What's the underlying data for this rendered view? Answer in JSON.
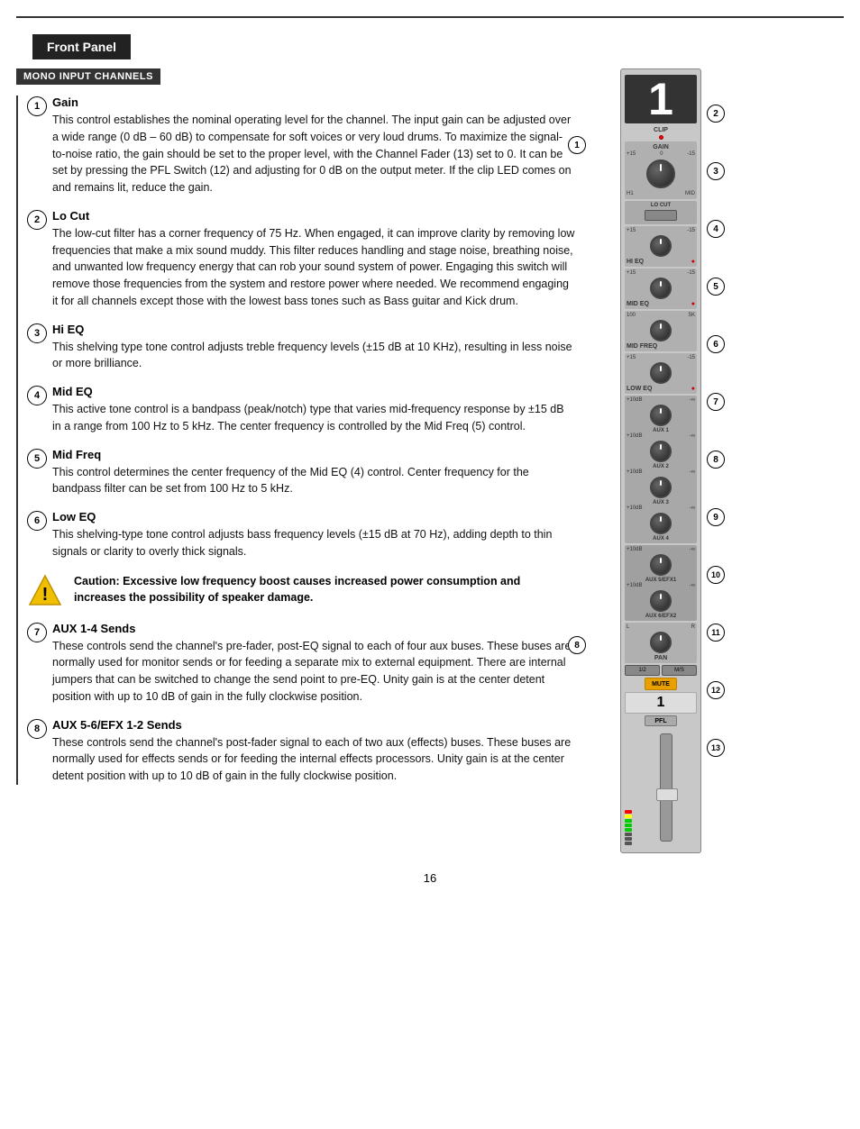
{
  "header": {
    "title": "Front Panel"
  },
  "section": {
    "badge": "MONO INPUT CHANNELS"
  },
  "items": [
    {
      "number": "1",
      "title": "Gain",
      "text": "This control establishes the nominal operating level for the channel. The input gain can be adjusted over a wide range (0 dB – 60 dB) to compensate for soft voices or very loud drums. To maximize the signal-to-noise ratio, the gain should be set to the proper level, with the Channel Fader (13) set to 0. It can be set by pressing the PFL Switch (12) and adjusting for 0 dB on the output meter. If the clip LED comes on and remains lit, reduce the gain."
    },
    {
      "number": "2",
      "title": "Lo Cut",
      "text": "The low-cut filter has a corner frequency of 75 Hz. When engaged, it can improve clarity by removing low frequencies that make a mix sound muddy. This filter reduces handling and stage noise, breathing noise, and unwanted low frequency energy that can rob your sound system of power. Engaging this switch will remove those frequencies from the system and restore power where needed. We recommend engaging it for all channels except those with the lowest bass tones such as Bass guitar and Kick drum."
    },
    {
      "number": "3",
      "title": "Hi EQ",
      "text": "This shelving type tone control adjusts treble frequency levels (±15 dB at 10 KHz), resulting in less noise or more brilliance."
    },
    {
      "number": "4",
      "title": "Mid EQ",
      "text": "This active tone control is a bandpass (peak/notch) type that varies mid-frequency response by ±15 dB in a range from 100 Hz to 5 kHz. The center frequency is controlled by the Mid Freq (5) control."
    },
    {
      "number": "5",
      "title": "Mid Freq",
      "text": "This control determines the center frequency of the Mid EQ (4) control. Center frequency for the bandpass filter can be set from 100 Hz to 5 kHz."
    },
    {
      "number": "6",
      "title": "Low EQ",
      "text": "This shelving-type tone control adjusts bass frequency levels (±15 dB at 70 Hz), adding depth to thin signals or clarity to overly thick signals."
    },
    {
      "number": "7",
      "title": "AUX 1-4 Sends",
      "text": "These controls send the channel's pre-fader, post-EQ signal to each of four aux buses. These buses are normally used for monitor sends or for feeding a separate mix to external equipment. There are internal jumpers that can be switched to change the send point to pre-EQ. Unity gain is at the center detent position with up to 10 dB of gain in the fully clockwise position."
    },
    {
      "number": "8",
      "title": "AUX 5-6/EFX 1-2 Sends",
      "text": "These controls send the channel's post-fader signal to each of two aux (effects) buses. These buses are normally used for effects sends or for feeding the internal effects processors. Unity gain is at the center detent position with up to 10 dB of gain in the fully clockwise position."
    }
  ],
  "caution": {
    "text": "Caution: Excessive low frequency boost causes increased power consumption and increases the possibility of speaker damage."
  },
  "mixer": {
    "channel_number": "1",
    "labels": {
      "mute": "MUTE",
      "pfl": "PFL",
      "pan": "PAN",
      "aux": "AUX"
    }
  },
  "page": {
    "number": "16"
  },
  "sidebar_numbers": [
    "2",
    "3",
    "4",
    "5",
    "6",
    "7",
    "8",
    "9",
    "10",
    "11",
    "12",
    "13"
  ]
}
